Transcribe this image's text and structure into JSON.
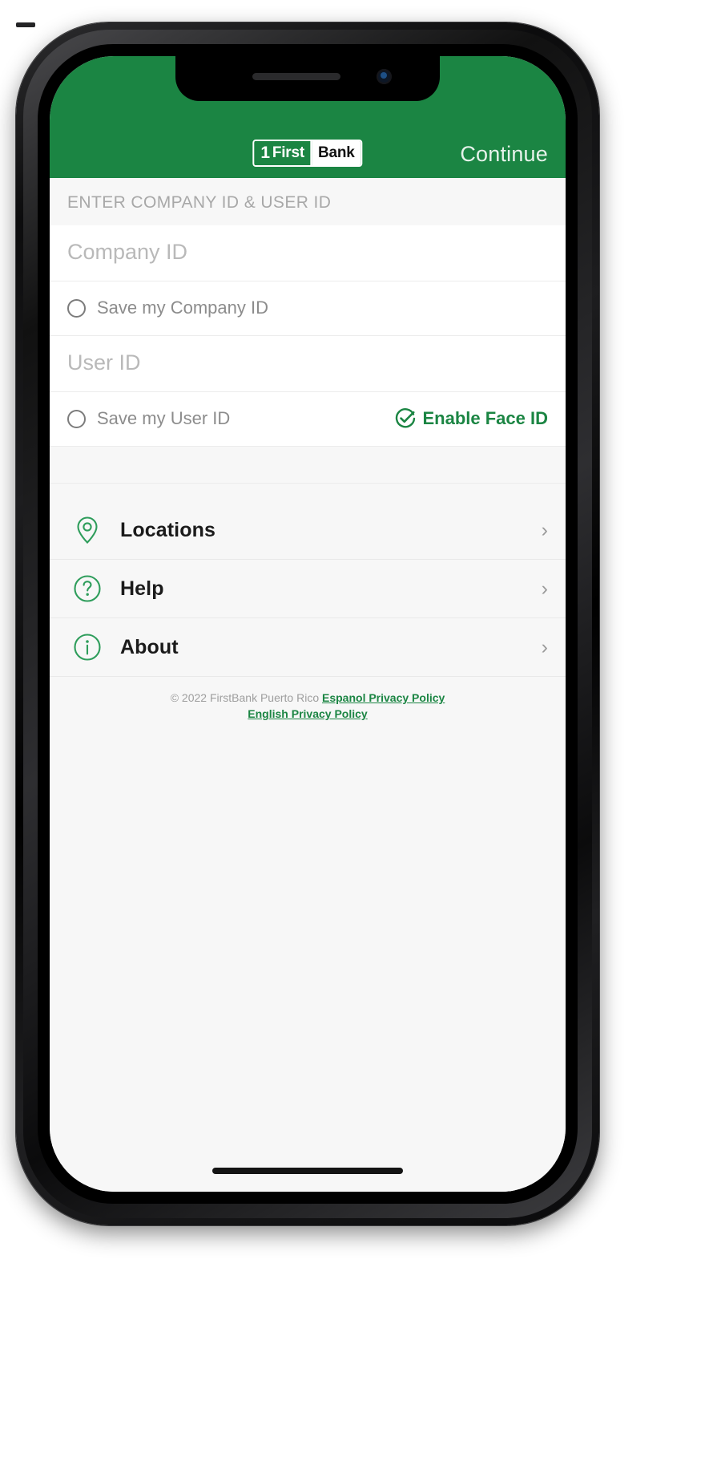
{
  "header": {
    "logo": {
      "one": "1",
      "first": "First",
      "bank": "Bank"
    },
    "continue_label": "Continue",
    "background_color": "#1b8543"
  },
  "form": {
    "section_label": "ENTER COMPANY ID & USER ID",
    "company_id": {
      "placeholder": "Company ID",
      "value": ""
    },
    "save_company_id_label": "Save my Company ID",
    "user_id": {
      "placeholder": "User ID",
      "value": ""
    },
    "save_user_id_label": "Save my User ID",
    "face_id": {
      "label": "Enable Face ID",
      "icon": "check-circle-icon",
      "color": "#1b8543"
    }
  },
  "menu": {
    "items": [
      {
        "label": "Locations",
        "icon": "map-pin-icon",
        "chevron": "›"
      },
      {
        "label": "Help",
        "icon": "question-circle-icon",
        "chevron": "›"
      },
      {
        "label": "About",
        "icon": "info-circle-icon",
        "chevron": "›"
      }
    ]
  },
  "footer": {
    "copyright": "© 2022 FirstBank Puerto Rico",
    "link_espanol": "Espanol Privacy Policy",
    "link_english": "English Privacy Policy"
  }
}
